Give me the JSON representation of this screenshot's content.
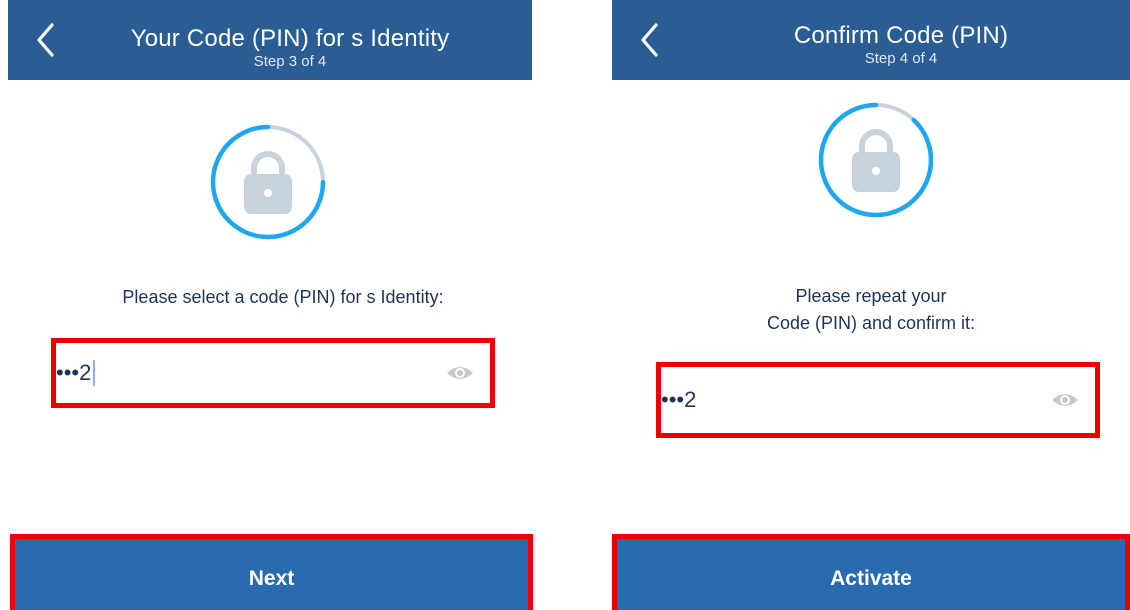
{
  "colors": {
    "header_bg": "#2a5d94",
    "button_bg": "#2a6aaf",
    "highlight": "#ee0000",
    "text_dark": "#1d3357",
    "progress_ring": "#1ea7ef",
    "ring_track": "#c9d3de",
    "lock_fill": "#c9d3de"
  },
  "step3": {
    "header": {
      "back_icon": "chevron-left-icon",
      "title": "Your Code (PIN) for s Identity",
      "step": "Step 3 of 4"
    },
    "lock": {
      "icon": "lock-icon",
      "progress": 0.75
    },
    "prompt": "Please select a code (PIN) for s Identity:",
    "pin": {
      "masked": "•••",
      "last_char": "2",
      "toggle_icon": "eye-icon"
    },
    "button_label": "Next"
  },
  "step4": {
    "header": {
      "back_icon": "chevron-left-icon",
      "title": "Confirm Code (PIN)",
      "step": "Step 4 of 4"
    },
    "lock": {
      "icon": "lock-icon",
      "progress": 0.88
    },
    "prompt_line1": "Please repeat your",
    "prompt_line2": "Code (PIN) and confirm it:",
    "pin": {
      "masked": "•••",
      "last_char": "2",
      "toggle_icon": "eye-icon"
    },
    "button_label": "Activate"
  }
}
